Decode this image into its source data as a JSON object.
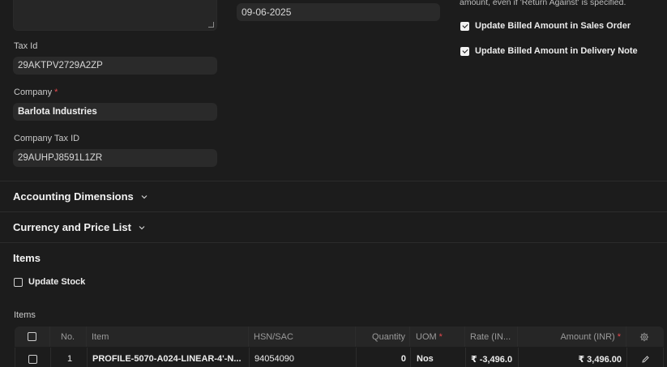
{
  "left_col": {
    "tax_id_label": "Tax Id",
    "tax_id_value": "29AKTPV2729A2ZP",
    "company_label": "Company",
    "company_required": "*",
    "company_value": "Barlota Industries",
    "company_tax_id_label": "Company Tax ID",
    "company_tax_id_value": "29AUHPJ8591L1ZR"
  },
  "mid_col": {
    "date_value": "09-06-2025"
  },
  "right_col": {
    "note_text": "amount, even if 'Return Against' is specified.",
    "checkboxes": [
      {
        "label": "Update Billed Amount in Sales Order",
        "checked": true
      },
      {
        "label": "Update Billed Amount in Delivery Note",
        "checked": true
      }
    ]
  },
  "sections": {
    "accounting_dimensions": "Accounting Dimensions",
    "currency_price_list": "Currency and Price List",
    "items": "Items"
  },
  "items_section": {
    "update_stock_label": "Update Stock",
    "update_stock_checked": false,
    "table_label": "Items",
    "columns": {
      "no": "No.",
      "item": "Item",
      "hsn": "HSN/SAC",
      "quantity": "Quantity",
      "uom": "UOM",
      "uom_required": "*",
      "rate": "Rate (IN...",
      "amount": "Amount (INR)",
      "amount_required": "*"
    },
    "rows": [
      {
        "no": "1",
        "item": "PROFILE-5070-A024-LINEAR-4'-N...",
        "hsn": "94054090",
        "quantity": "0",
        "uom": "Nos",
        "rate": "₹ -3,496.0",
        "amount": "₹ 3,496.00"
      }
    ]
  },
  "colors": {
    "background": "#1c1c1c",
    "field_bg": "#2a2a2a",
    "required": "#e5484d"
  }
}
